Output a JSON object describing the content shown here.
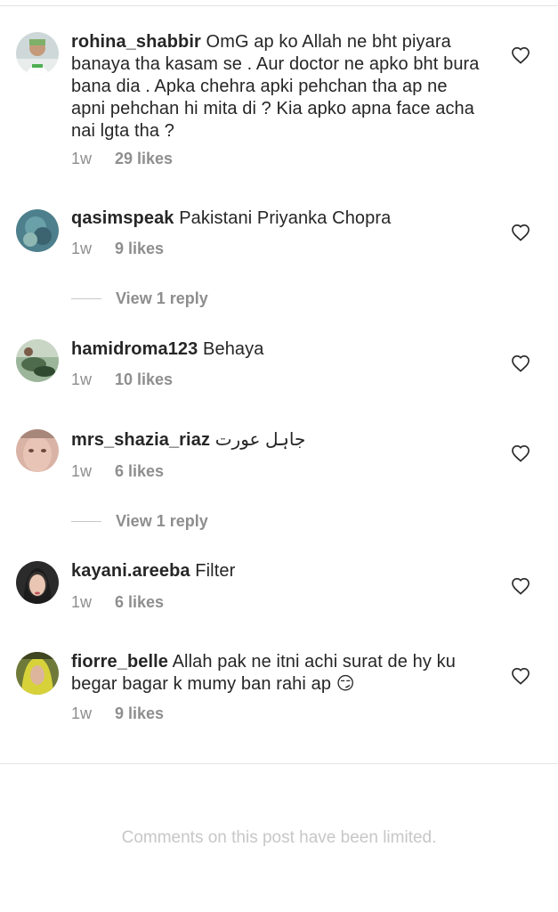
{
  "comments": [
    {
      "username": "rohina_shabbir",
      "text": "OmG ap ko Allah ne bht piyara banaya tha kasam se . Aur doctor ne apko bht bura bana dia . Apka chehra apki pehchan tha ap ne apni pehchan hi mita di ? Kia apko apna face acha nai lgta tha ?",
      "time": "1w",
      "likes": "29 likes"
    },
    {
      "username": "qasimspeak",
      "text": "Pakistani Priyanka Chopra",
      "time": "1w",
      "likes": "9 likes",
      "view_reply": "View 1 reply"
    },
    {
      "username": "hamidroma123",
      "text": "Behaya",
      "time": "1w",
      "likes": "10 likes"
    },
    {
      "username": "mrs_shazia_riaz",
      "text": "جاہل عورت",
      "time": "1w",
      "likes": "6 likes",
      "view_reply": "View 1 reply"
    },
    {
      "username": "kayani.areeba",
      "text": "Filter",
      "time": "1w",
      "likes": "6 likes"
    },
    {
      "username": "fiorre_belle",
      "text": "Allah pak ne itni achi surat de hy ku begar bagar k mumy ban rahi ap 😏",
      "time": "1w",
      "likes": "9 likes"
    }
  ],
  "icons": {
    "like": "heart-outline-icon"
  },
  "colors": {
    "text": "#262626",
    "secondary": "#8e8e8e",
    "muted": "#c7c7c7"
  },
  "footer": {
    "limited_text": "Comments on this post have been limited."
  }
}
